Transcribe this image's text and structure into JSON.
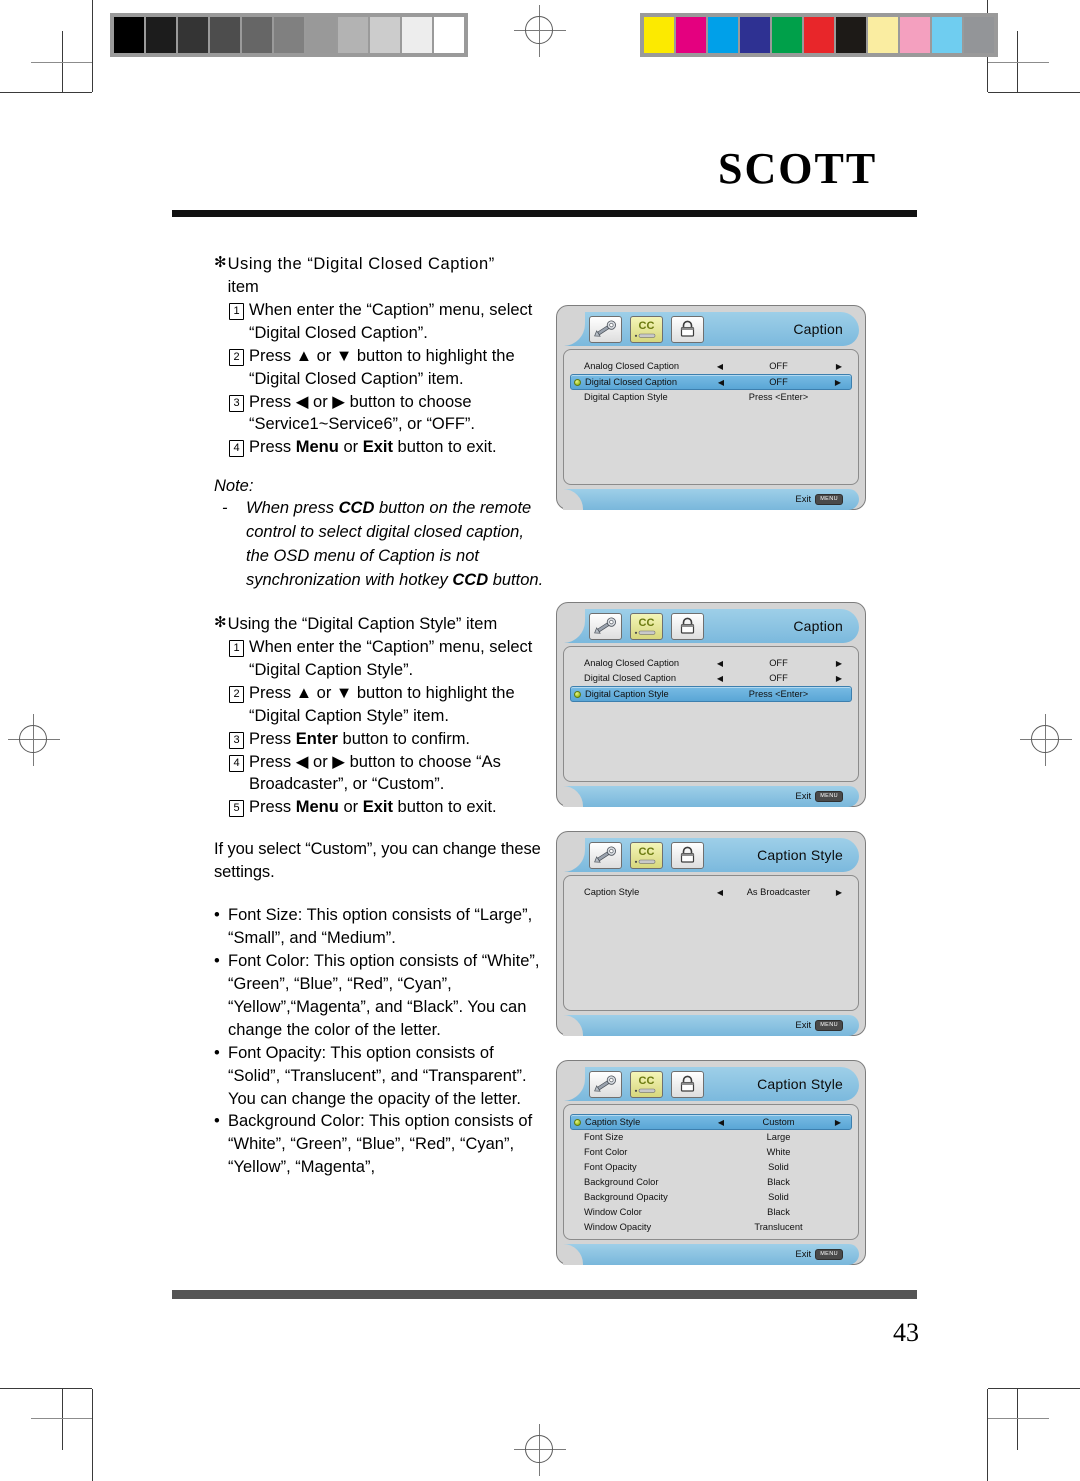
{
  "brand": {
    "logo": "SCOTT"
  },
  "page": {
    "number": "43"
  },
  "press_marks": {
    "grayscale_label": "grayscale-calibration-strip",
    "grayscale_swatches": [
      "#000000",
      "#1c1c1c",
      "#343434",
      "#4d4d4d",
      "#666666",
      "#808080",
      "#999999",
      "#b3b3b3",
      "#cccccc",
      "#ededed",
      "#ffffff"
    ],
    "color_label": "color-calibration-strip",
    "color_swatches": [
      "#fcea00",
      "#e4007f",
      "#00a0e9",
      "#2e3192",
      "#00a04a",
      "#e8262a",
      "#1d1a17",
      "#faeda1",
      "#f4a0bf",
      "#6fcdf0",
      "#939598"
    ]
  },
  "content": {
    "section1": {
      "star": "✻",
      "heading": "Using the “Digital Closed Caption”",
      "heading_line2": "item",
      "steps": [
        {
          "num": "1",
          "text": "When enter the “Caption” menu, select “Digital Closed Caption”."
        },
        {
          "num": "2",
          "text_a": "Press ▲ or ▼ button to highlight the “Digital Closed Caption” item."
        },
        {
          "num": "3",
          "text_a": "Press ◀ or ▶ button to choose “Service1~Service6”, or “OFF”."
        },
        {
          "num": "4",
          "pre": "Press ",
          "bold1": "Menu",
          "mid": " or ",
          "bold2": "Exit",
          "post": " button to exit."
        }
      ]
    },
    "note": {
      "title": "Note:",
      "dash": "-",
      "pre": "When press ",
      "bold1": "CCD",
      "mid": " button on the remote control to select digital closed caption, the OSD menu of Caption is not synchronization with hotkey ",
      "bold2": "CCD",
      "post": " button."
    },
    "section2": {
      "star": "✻",
      "heading": "Using the “Digital Caption Style” item",
      "steps": [
        {
          "num": "1",
          "text": "When enter the “Caption” menu, select “Digital Caption Style”."
        },
        {
          "num": "2",
          "text_a": "Press ▲ or ▼ button to highlight the “Digital Caption Style” item."
        },
        {
          "num": "3",
          "pre": "Press ",
          "bold1": "Enter",
          "post": " button to confirm."
        },
        {
          "num": "4",
          "text_a": "Press ◀ or ▶ button to choose “As Broadcaster”, or “Custom”."
        },
        {
          "num": "5",
          "pre": "Press ",
          "bold1": "Menu",
          "mid": " or ",
          "bold2": "Exit",
          "post": " button to exit."
        }
      ]
    },
    "custom_intro": "If you select “Custom”, you can change these settings.",
    "bullets": [
      {
        "dot": "•",
        "text": "Font Size:  This option consists of “Large”, “Small”, and “Medium”."
      },
      {
        "dot": "•",
        "text": "Font Color: This option consists of “White”, “Green”, “Blue”, “Red”, “Cyan”, “Yellow”,“Magenta”, and “Black”. You can change the color of the letter."
      },
      {
        "dot": "•",
        "text": "Font Opacity: This option consists of “Solid”, “Translucent”, and “Transparent”. You can change the opacity of the letter."
      },
      {
        "dot": "•",
        "text": "Background Color: This option consists of “White”, “Green”, “Blue”, “Red”, “Cyan”,  “Yellow”, “Magenta”,"
      }
    ]
  },
  "osd_common": {
    "icons": [
      {
        "name": "wrench-icon",
        "label": "Setup"
      },
      {
        "name": "cc-icon",
        "label": "CC"
      },
      {
        "name": "lock-icon",
        "label": "Lock"
      }
    ],
    "cc_icon_text": "CC",
    "exit_label": "Exit",
    "exit_key": "MENU"
  },
  "osd_panels": [
    {
      "id": "caption-menu-digital-closed-caption",
      "title": "Caption",
      "rows": [
        {
          "label": "Analog Closed Caption",
          "left": "◀",
          "value": "OFF",
          "right": "▶",
          "selected": false,
          "arrows": true
        },
        {
          "label": "Digital Closed Caption",
          "left": "◀",
          "value": "OFF",
          "right": "▶",
          "selected": true,
          "arrows": true
        },
        {
          "label": "Digital Caption Style",
          "left": "",
          "value": "Press <Enter>",
          "right": "",
          "selected": false,
          "arrows": false
        }
      ]
    },
    {
      "id": "caption-menu-digital-caption-style",
      "title": "Caption",
      "rows": [
        {
          "label": "Analog Closed Caption",
          "left": "◀",
          "value": "OFF",
          "right": "▶",
          "selected": false,
          "arrows": true
        },
        {
          "label": "Digital Closed Caption",
          "left": "◀",
          "value": "OFF",
          "right": "▶",
          "selected": false,
          "arrows": true
        },
        {
          "label": "Digital Caption Style",
          "left": "",
          "value": "Press <Enter>",
          "right": "",
          "selected": true,
          "arrows": false
        }
      ]
    },
    {
      "id": "caption-style-as-broadcaster",
      "title": "Caption Style",
      "rows": [
        {
          "label": "Caption Style",
          "left": "◀",
          "value": "As Broadcaster",
          "right": "▶",
          "selected": false,
          "arrows": true
        }
      ]
    },
    {
      "id": "caption-style-custom",
      "title": "Caption Style",
      "rows": [
        {
          "label": "Caption Style",
          "left": "◀",
          "value": "Custom",
          "right": "▶",
          "selected": true,
          "arrows": true
        },
        {
          "label": "Font  Size",
          "left": "",
          "value": "Large",
          "right": "",
          "selected": false,
          "arrows": false
        },
        {
          "label": "Font  Color",
          "left": "",
          "value": "White",
          "right": "",
          "selected": false,
          "arrows": false
        },
        {
          "label": "Font  Opacity",
          "left": "",
          "value": "Solid",
          "right": "",
          "selected": false,
          "arrows": false
        },
        {
          "label": "Background  Color",
          "left": "",
          "value": "Black",
          "right": "",
          "selected": false,
          "arrows": false
        },
        {
          "label": "Background  Opacity",
          "left": "",
          "value": "Solid",
          "right": "",
          "selected": false,
          "arrows": false
        },
        {
          "label": "Window  Color",
          "left": "",
          "value": "Black",
          "right": "",
          "selected": false,
          "arrows": false
        },
        {
          "label": "Window  Opacity",
          "left": "",
          "value": "Translucent",
          "right": "",
          "selected": false,
          "arrows": false
        }
      ]
    }
  ]
}
